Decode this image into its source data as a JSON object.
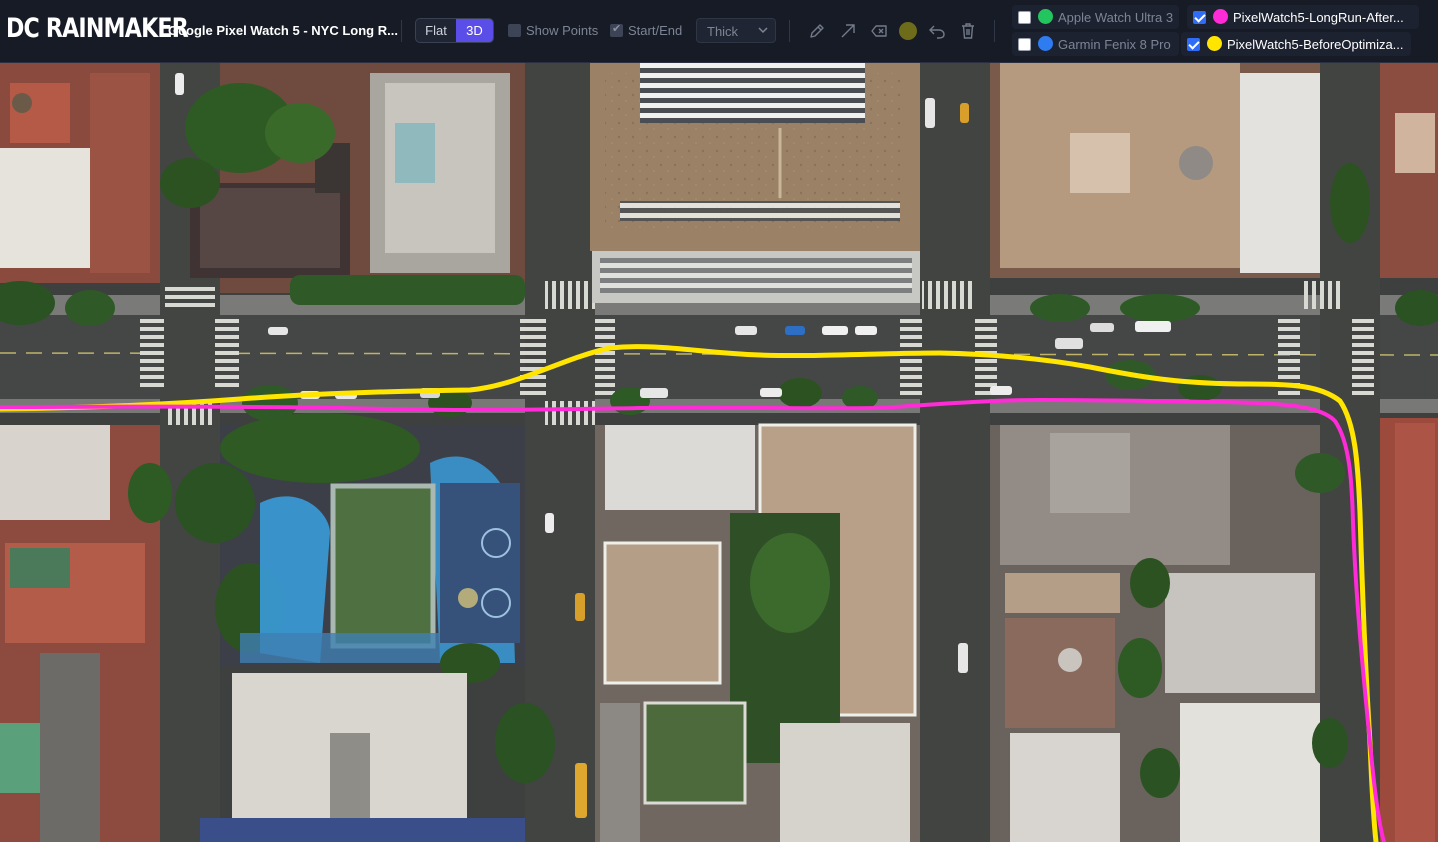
{
  "brand": {
    "name": "DC RAINMAKER"
  },
  "activity": {
    "title": "Google Pixel Watch 5 - NYC Long R..."
  },
  "view_toggle": {
    "flat_label": "Flat",
    "threed_label": "3D",
    "active": "3D",
    "active_color": "#5b4ee8"
  },
  "options": {
    "show_points_label": "Show Points",
    "show_points_checked": false,
    "start_end_label": "Start/End",
    "start_end_checked": true,
    "line_weight": "Thick"
  },
  "tools": {
    "icons": [
      "pencil-icon",
      "arrow-icon",
      "eraser-icon",
      "color-swatch",
      "undo-icon",
      "trash-icon"
    ],
    "current_color": "#6e6c1b"
  },
  "legend": {
    "tracks": [
      {
        "label": "Apple Watch Ultra 3",
        "color": "#22c55e",
        "checked": false
      },
      {
        "label": "PixelWatch5-LongRun-After...",
        "color": "#ff2bd6",
        "checked": true
      },
      {
        "label": "Garmin Fenix 8 Pro",
        "color": "#2f7bf0",
        "checked": false
      },
      {
        "label": "PixelWatch5-BeforeOptimiza...",
        "color": "#ffe500",
        "checked": true
      }
    ]
  }
}
